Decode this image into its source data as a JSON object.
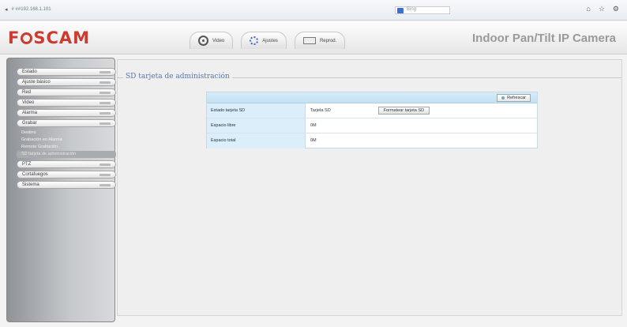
{
  "browser": {
    "url": "#  ##192.168.1.101",
    "search_placeholder": "Bing",
    "icons": [
      "home-icon",
      "star-icon",
      "gear-icon"
    ]
  },
  "header": {
    "logo": "FOSCAM",
    "product_title": "Indoor Pan/Tilt IP Camera",
    "tabs": [
      {
        "label": "Video",
        "icon": "camera-icon"
      },
      {
        "label": "Ajustes",
        "icon": "gear-icon"
      },
      {
        "label": "Reprod.",
        "icon": "playback-icon"
      }
    ]
  },
  "sidebar": {
    "items": [
      {
        "label": "Estado"
      },
      {
        "label": "Ajuste básico"
      },
      {
        "label": "Red"
      },
      {
        "label": "Video"
      },
      {
        "label": "Alarma"
      },
      {
        "label": "Grabar"
      }
    ],
    "sub_items": [
      {
        "label": "Destino"
      },
      {
        "label": "Grabación en Alarma"
      },
      {
        "label": "Remote Grabación"
      },
      {
        "label": "SD tarjeta de administración",
        "active": true
      }
    ],
    "items_after": [
      {
        "label": "PTZ"
      },
      {
        "label": "Cortafuegos"
      },
      {
        "label": "Sistema"
      }
    ]
  },
  "main": {
    "section_title": "SD tarjeta de administración",
    "refresh_label": "Refrescar",
    "rows": [
      {
        "label": "Estado tarjeta SD",
        "value": "Tarjeta SD",
        "button": "Formatear tarjeta SD"
      },
      {
        "label": "Espacio libre",
        "value": "0M",
        "button": ""
      },
      {
        "label": "Espacio total",
        "value": "0M",
        "button": ""
      }
    ]
  }
}
